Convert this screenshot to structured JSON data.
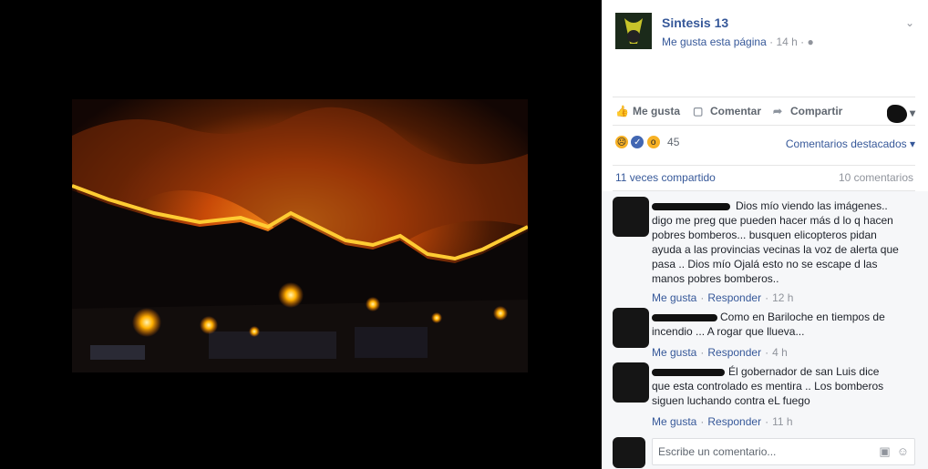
{
  "page": {
    "name": "Sintesis 13",
    "like_link": "Me gusta esta página",
    "time": "14 h",
    "privacy_icon": "globe-icon"
  },
  "actions": {
    "like": "Me gusta",
    "comment": "Comentar",
    "share": "Compartir"
  },
  "reactions": {
    "count": "45",
    "types": [
      "sad",
      "like",
      "wow"
    ],
    "sort_label": "Comentarios destacados"
  },
  "stats": {
    "shares": "11 veces compartido",
    "comments": "10 comentarios"
  },
  "comments": [
    {
      "text": "Dios mío viendo las imágenes.. digo me preg que pueden hacer más d lo q hacen pobres bomberos... busquen elicopteros pidan ayuda a las provincias vecinas la voz de alerta que pasa .. Dios mío Ojalá esto no se escape d las manos pobres bomberos..",
      "like": "Me gusta",
      "reply": "Responder",
      "time": "12 h"
    },
    {
      "text": "Como en Bariloche en tiempos de incendio ... A rogar que llueva...",
      "like": "Me gusta",
      "reply": "Responder",
      "time": "4 h"
    },
    {
      "text": "Él gobernador de san Luis dice que esta controlado es mentira .. Los bomberos siguen luchando contra eL fuego",
      "like": "Me gusta",
      "reply": "Responder",
      "time": "11 h"
    }
  ],
  "composer": {
    "placeholder": "Escribe un comentario..."
  },
  "colors": {
    "link": "#365899",
    "muted": "#90949c",
    "fire": "#ff8a00"
  }
}
